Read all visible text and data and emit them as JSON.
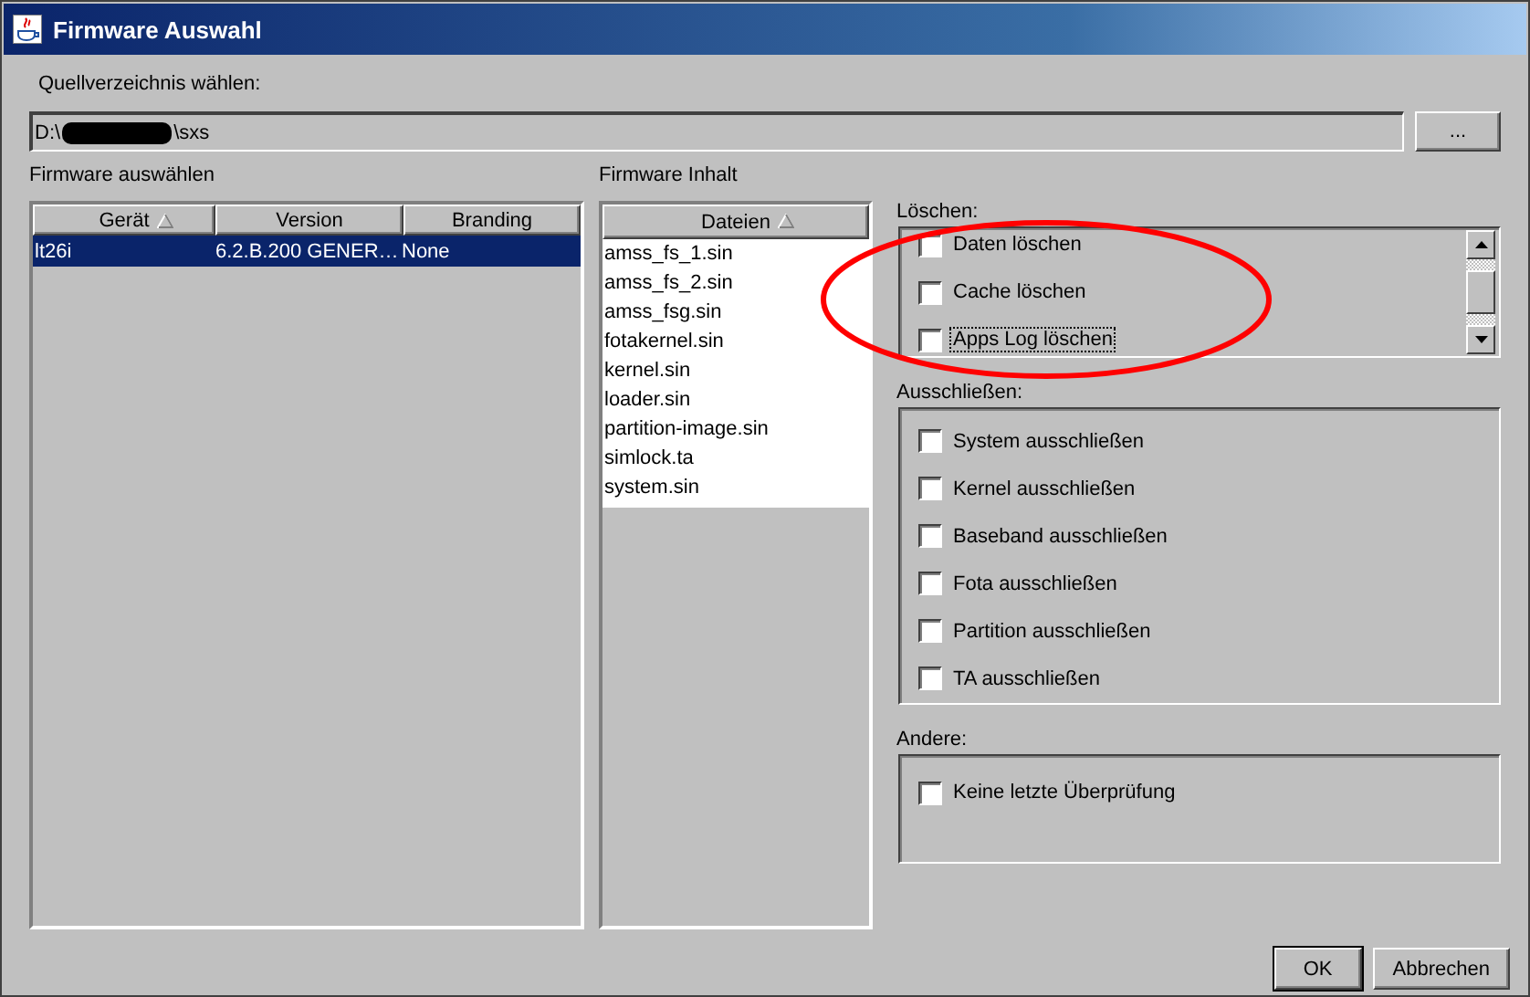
{
  "window": {
    "title": "Firmware Auswahl"
  },
  "source": {
    "label": "Quellverzeichnis wählen:",
    "path_start": "D:\\",
    "path_end": "\\sxs",
    "browse_button": "..."
  },
  "firmware_table": {
    "label": "Firmware auswählen",
    "columns": [
      {
        "label": "Gerät",
        "sorted": true
      },
      {
        "label": "Version",
        "sorted": false
      },
      {
        "label": "Branding",
        "sorted": false
      }
    ],
    "rows": [
      {
        "cells": [
          "lt26i",
          "6.2.B.200 GENER…",
          "None"
        ],
        "selected": true
      }
    ]
  },
  "content": {
    "label": "Firmware Inhalt",
    "column": {
      "label": "Dateien",
      "sorted": true
    },
    "files": [
      "amss_fs_1.sin",
      "amss_fs_2.sin",
      "amss_fsg.sin",
      "fotakernel.sin",
      "kernel.sin",
      "loader.sin",
      "partition-image.sin",
      "simlock.ta",
      "system.sin"
    ]
  },
  "groups": [
    {
      "label": "Löschen:",
      "scrollable": true,
      "options": [
        {
          "label": "Daten löschen",
          "checked": false,
          "focused": false
        },
        {
          "label": "Cache löschen",
          "checked": false,
          "focused": false
        },
        {
          "label": "Apps Log löschen",
          "checked": false,
          "focused": true
        }
      ]
    },
    {
      "label": "Ausschließen:",
      "scrollable": false,
      "options": [
        {
          "label": "System ausschließen",
          "checked": false,
          "focused": false
        },
        {
          "label": "Kernel ausschließen",
          "checked": false,
          "focused": false
        },
        {
          "label": "Baseband ausschließen",
          "checked": false,
          "focused": false
        },
        {
          "label": "Fota ausschließen",
          "checked": false,
          "focused": false
        },
        {
          "label": "Partition ausschließen",
          "checked": false,
          "focused": false
        },
        {
          "label": "TA ausschließen",
          "checked": false,
          "focused": false
        }
      ]
    },
    {
      "label": "Andere:",
      "scrollable": false,
      "options": [
        {
          "label": "Keine letzte Überprüfung",
          "checked": false,
          "focused": false
        }
      ]
    }
  ],
  "buttons": [
    {
      "label": "OK",
      "default": true
    },
    {
      "label": "Abbrechen",
      "default": false
    }
  ],
  "annotation": {
    "kind": "ellipse",
    "color": "#ff0000"
  }
}
